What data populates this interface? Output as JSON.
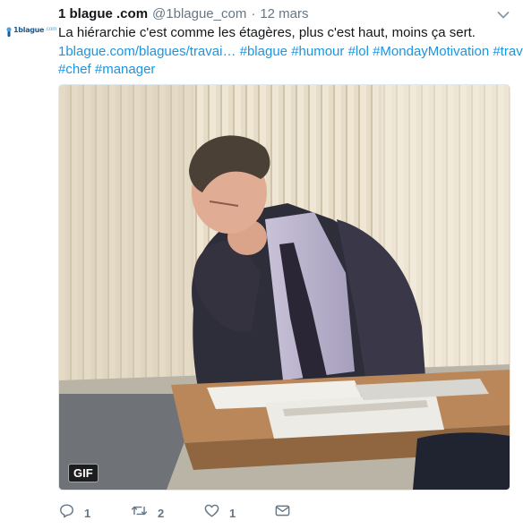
{
  "tweet": {
    "avatar_text": "1blague",
    "avatar_domain": ".com",
    "name": "1 blague .com",
    "handle": "@1blague_com",
    "separator": "·",
    "date": "12 mars",
    "text": "La hiérarchie c'est comme les étagères, plus c'est haut, moins ça sert.",
    "link": "1blague.com/blagues/travai…",
    "hashtags": [
      "#blague",
      "#humour",
      "#lol",
      "#MondayMotivation",
      "#travail",
      "#chef",
      "#manager"
    ]
  },
  "media": {
    "badge": "GIF"
  },
  "actions": {
    "reply_count": "1",
    "retweet_count": "2",
    "like_count": "1"
  },
  "colors": {
    "link": "#1b95e0",
    "muted": "#657786",
    "avatar_brand": "#1d5a8f"
  },
  "icons": [
    "caret-down-icon",
    "reply-icon",
    "retweet-icon",
    "like-icon",
    "direct-message-icon"
  ]
}
